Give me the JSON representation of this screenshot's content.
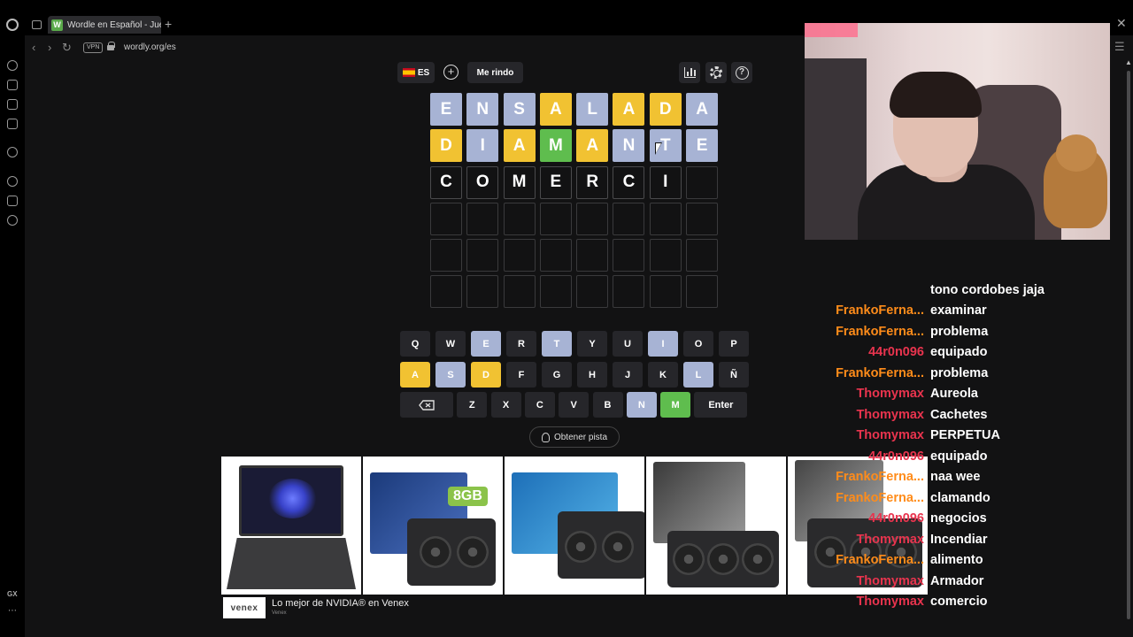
{
  "browser": {
    "tab_title": "Wordle en Español - Jueg",
    "tab_favicon": "W",
    "url": "wordly.org/es",
    "vpn_label": "VPN",
    "sidebar_label": "GX"
  },
  "header": {
    "lang_label": "ES",
    "give_up_label": "Me rindo",
    "icons": [
      "plus-icon",
      "stats-icon",
      "gear-icon",
      "help-icon"
    ]
  },
  "board": {
    "rows": [
      [
        {
          "l": "E",
          "s": "absent"
        },
        {
          "l": "N",
          "s": "absent"
        },
        {
          "l": "S",
          "s": "absent"
        },
        {
          "l": "A",
          "s": "present"
        },
        {
          "l": "L",
          "s": "absent"
        },
        {
          "l": "A",
          "s": "present"
        },
        {
          "l": "D",
          "s": "present"
        },
        {
          "l": "A",
          "s": "absent"
        }
      ],
      [
        {
          "l": "D",
          "s": "present"
        },
        {
          "l": "I",
          "s": "absent"
        },
        {
          "l": "A",
          "s": "present"
        },
        {
          "l": "M",
          "s": "correct"
        },
        {
          "l": "A",
          "s": "present"
        },
        {
          "l": "N",
          "s": "absent"
        },
        {
          "l": "T",
          "s": "absent"
        },
        {
          "l": "E",
          "s": "absent"
        }
      ],
      [
        {
          "l": "C",
          "s": "typed"
        },
        {
          "l": "O",
          "s": "typed"
        },
        {
          "l": "M",
          "s": "typed"
        },
        {
          "l": "E",
          "s": "typed"
        },
        {
          "l": "R",
          "s": "typed"
        },
        {
          "l": "C",
          "s": "typed"
        },
        {
          "l": "I",
          "s": "typed"
        },
        {
          "l": "",
          "s": "empty"
        }
      ],
      [
        {
          "l": "",
          "s": "empty"
        },
        {
          "l": "",
          "s": "empty"
        },
        {
          "l": "",
          "s": "empty"
        },
        {
          "l": "",
          "s": "empty"
        },
        {
          "l": "",
          "s": "empty"
        },
        {
          "l": "",
          "s": "empty"
        },
        {
          "l": "",
          "s": "empty"
        },
        {
          "l": "",
          "s": "empty"
        }
      ],
      [
        {
          "l": "",
          "s": "empty"
        },
        {
          "l": "",
          "s": "empty"
        },
        {
          "l": "",
          "s": "empty"
        },
        {
          "l": "",
          "s": "empty"
        },
        {
          "l": "",
          "s": "empty"
        },
        {
          "l": "",
          "s": "empty"
        },
        {
          "l": "",
          "s": "empty"
        },
        {
          "l": "",
          "s": "empty"
        }
      ],
      [
        {
          "l": "",
          "s": "empty"
        },
        {
          "l": "",
          "s": "empty"
        },
        {
          "l": "",
          "s": "empty"
        },
        {
          "l": "",
          "s": "empty"
        },
        {
          "l": "",
          "s": "empty"
        },
        {
          "l": "",
          "s": "empty"
        },
        {
          "l": "",
          "s": "empty"
        },
        {
          "l": "",
          "s": "empty"
        }
      ]
    ]
  },
  "keyboard": {
    "rows": [
      [
        {
          "k": "Q"
        },
        {
          "k": "W"
        },
        {
          "k": "E",
          "s": "absent"
        },
        {
          "k": "R"
        },
        {
          "k": "T",
          "s": "absent"
        },
        {
          "k": "Y"
        },
        {
          "k": "U"
        },
        {
          "k": "I",
          "s": "absent"
        },
        {
          "k": "O"
        },
        {
          "k": "P"
        }
      ],
      [
        {
          "k": "A",
          "s": "present"
        },
        {
          "k": "S",
          "s": "absent"
        },
        {
          "k": "D",
          "s": "present"
        },
        {
          "k": "F"
        },
        {
          "k": "G"
        },
        {
          "k": "H"
        },
        {
          "k": "J"
        },
        {
          "k": "K"
        },
        {
          "k": "L",
          "s": "absent"
        },
        {
          "k": "Ñ"
        }
      ],
      [
        {
          "k": "backspace",
          "icon": "backspace-icon"
        },
        {
          "k": "Z"
        },
        {
          "k": "X"
        },
        {
          "k": "C"
        },
        {
          "k": "V"
        },
        {
          "k": "B"
        },
        {
          "k": "N",
          "s": "absent"
        },
        {
          "k": "M",
          "s": "correct"
        },
        {
          "k": "Enter"
        }
      ]
    ]
  },
  "hint": {
    "label": "Obtener pista"
  },
  "ad": {
    "brand": "venex",
    "title": "Lo mejor de NVIDIA® en Venex",
    "subtitle": "Venex",
    "badge": "8GB",
    "products": [
      "laptop",
      "galax-5060ti",
      "gigabyte-5070",
      "asus-prime-5060ti",
      "gpu-5060"
    ]
  },
  "chat": [
    {
      "user": "",
      "msg": "tono cordobes jaja",
      "color": "#ff8c1a"
    },
    {
      "user": "FrankoFerna...",
      "msg": "examinar",
      "color": "#ff8c1a"
    },
    {
      "user": "FrankoFerna...",
      "msg": "problema",
      "color": "#ff8c1a"
    },
    {
      "user": "44r0n096",
      "msg": "equipado",
      "color": "#e8344e"
    },
    {
      "user": "FrankoFerna...",
      "msg": "problema",
      "color": "#ff8c1a"
    },
    {
      "user": "Thomymax",
      "msg": "Aureola",
      "color": "#e8344e"
    },
    {
      "user": "Thomymax",
      "msg": "Cachetes",
      "color": "#e8344e"
    },
    {
      "user": "Thomymax",
      "msg": "PERPETUA",
      "color": "#e8344e"
    },
    {
      "user": "44r0n096",
      "msg": "equipado",
      "color": "#e8344e"
    },
    {
      "user": "FrankoFerna...",
      "msg": "naa wee",
      "color": "#ff8c1a"
    },
    {
      "user": "FrankoFerna...",
      "msg": "clamando",
      "color": "#ff8c1a"
    },
    {
      "user": "44r0n096",
      "msg": "negocios",
      "color": "#e8344e"
    },
    {
      "user": "Thomymax",
      "msg": "Incendiar",
      "color": "#e8344e"
    },
    {
      "user": "FrankoFerna...",
      "msg": "alimento",
      "color": "#ff8c1a"
    },
    {
      "user": "Thomymax",
      "msg": "Armador",
      "color": "#e8344e"
    },
    {
      "user": "Thomymax",
      "msg": "comercio",
      "color": "#e8344e"
    }
  ]
}
